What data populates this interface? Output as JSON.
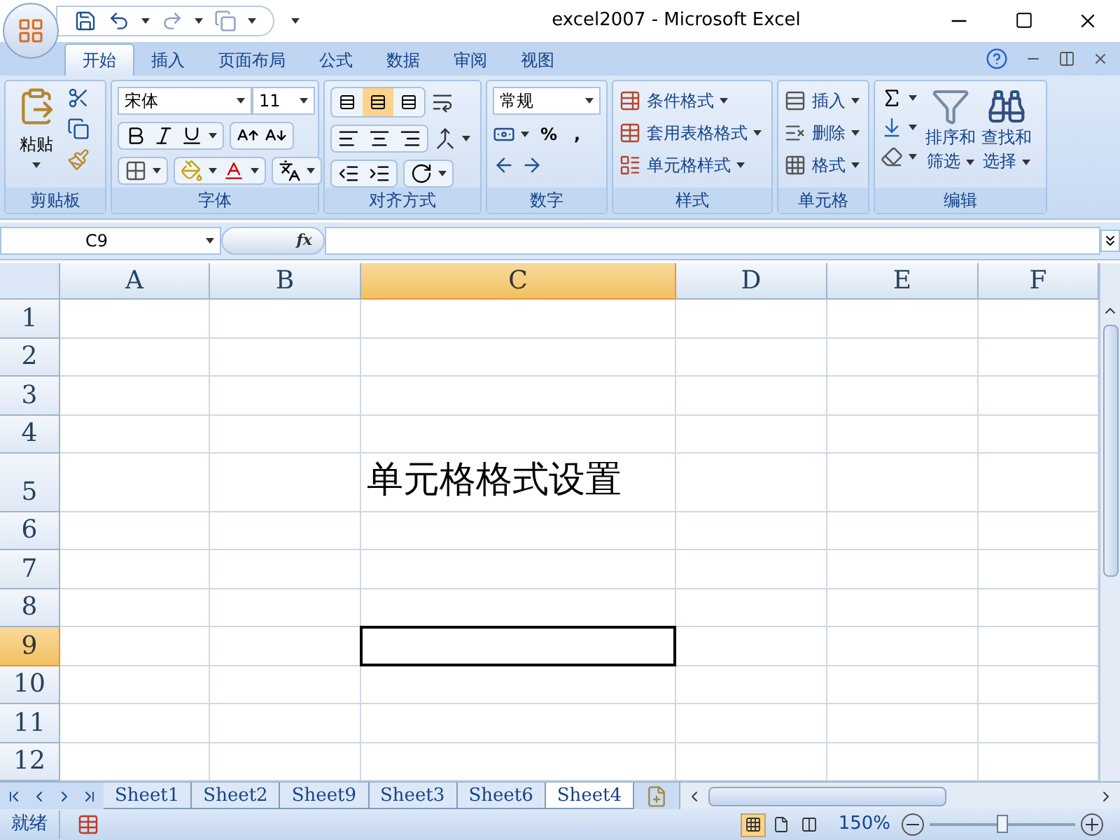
{
  "window": {
    "title": "excel2007 - Microsoft Excel"
  },
  "tabs": [
    {
      "label": "开始",
      "selected": true
    },
    {
      "label": "插入",
      "selected": false
    },
    {
      "label": "页面布局",
      "selected": false
    },
    {
      "label": "公式",
      "selected": false
    },
    {
      "label": "数据",
      "selected": false
    },
    {
      "label": "审阅",
      "selected": false
    },
    {
      "label": "视图",
      "selected": false
    }
  ],
  "ribbon": {
    "clipboard": {
      "label": "剪贴板",
      "paste": "粘贴"
    },
    "font": {
      "label": "字体",
      "family": "宋体",
      "size": "11"
    },
    "alignment": {
      "label": "对齐方式",
      "vertical": [
        {
          "selected": false
        },
        {
          "selected": true
        },
        {
          "selected": false
        }
      ]
    },
    "number": {
      "label": "数字",
      "format": "常规",
      "percent": "%",
      "comma": ","
    },
    "styles": {
      "label": "样式",
      "items": [
        "条件格式",
        "套用表格格式",
        "单元格样式"
      ]
    },
    "cells": {
      "label": "单元格",
      "items": [
        "插入",
        "删除",
        "格式"
      ]
    },
    "editing": {
      "label": "编辑",
      "sort": [
        "排序和",
        "筛选"
      ],
      "find": [
        "查找和",
        "选择"
      ]
    }
  },
  "formula_bar": {
    "name_box": "C9",
    "fx": "fx"
  },
  "columns": [
    {
      "label": "A",
      "selected": false
    },
    {
      "label": "B",
      "selected": false
    },
    {
      "label": "C",
      "selected": true
    },
    {
      "label": "D",
      "selected": false
    },
    {
      "label": "E",
      "selected": false
    },
    {
      "label": "F",
      "selected": false
    }
  ],
  "rows": [
    {
      "label": "1",
      "selected": false
    },
    {
      "label": "2",
      "selected": false
    },
    {
      "label": "3",
      "selected": false
    },
    {
      "label": "4",
      "selected": false
    },
    {
      "label": "5",
      "selected": false,
      "cells": [
        null,
        null,
        "单元格格式设置",
        null,
        null,
        null
      ]
    },
    {
      "label": "6",
      "selected": false
    },
    {
      "label": "7",
      "selected": false
    },
    {
      "label": "8",
      "selected": false
    },
    {
      "label": "9",
      "selected": true
    },
    {
      "label": "10",
      "selected": false
    },
    {
      "label": "11",
      "selected": false
    },
    {
      "label": "12",
      "selected": false
    }
  ],
  "sheet_tabs": [
    {
      "label": "Sheet1",
      "selected": false
    },
    {
      "label": "Sheet2",
      "selected": false
    },
    {
      "label": "Sheet9",
      "selected": false
    },
    {
      "label": "Sheet3",
      "selected": false
    },
    {
      "label": "Sheet6",
      "selected": false
    },
    {
      "label": "Sheet4",
      "selected": true
    }
  ],
  "status_bar": {
    "status": "就绪",
    "views": [
      {
        "selected": true
      },
      {
        "selected": false
      },
      {
        "selected": false
      }
    ],
    "zoom": "150%",
    "zoom_slider": {
      "level": 0.5
    }
  }
}
